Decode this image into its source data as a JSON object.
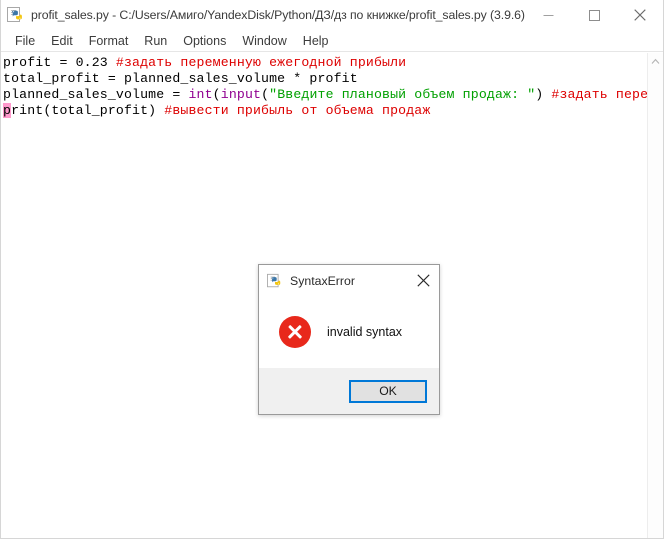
{
  "window": {
    "title": "profit_sales.py - C:/Users/Амиго/YandexDisk/Python/ДЗ/дз по книжке/profit_sales.py (3.9.6)",
    "app_icon": "python-icon",
    "controls": {
      "minimize": "minimize-icon",
      "maximize": "maximize-icon",
      "close": "close-icon"
    }
  },
  "menubar": {
    "items": [
      {
        "label": "File"
      },
      {
        "label": "Edit"
      },
      {
        "label": "Format"
      },
      {
        "label": "Run"
      },
      {
        "label": "Options"
      },
      {
        "label": "Window"
      },
      {
        "label": "Help"
      }
    ]
  },
  "editor": {
    "lines": [
      {
        "segments": [
          {
            "text": "profit = 0.23 ",
            "kind": "plain"
          },
          {
            "text": "#задать переменную ежегодной прибыли",
            "kind": "comment"
          }
        ]
      },
      {
        "segments": [
          {
            "text": "total_profit = planned_sales_volume * profit",
            "kind": "plain"
          }
        ]
      },
      {
        "segments": [
          {
            "text": "planned_sales_volume = ",
            "kind": "plain"
          },
          {
            "text": "int",
            "kind": "builtin"
          },
          {
            "text": "(",
            "kind": "plain"
          },
          {
            "text": "input",
            "kind": "builtin"
          },
          {
            "text": "(",
            "kind": "plain"
          },
          {
            "text": "\"Введите плановый объем продаж: \"",
            "kind": "string"
          },
          {
            "text": ") ",
            "kind": "plain"
          },
          {
            "text": "#задать пере",
            "kind": "comment"
          }
        ]
      },
      {
        "segments": [
          {
            "text": "p",
            "kind": "error-highlight"
          },
          {
            "text": "rint(total_profit) ",
            "kind": "plain"
          },
          {
            "text": "#вывести прибыль от объема продаж",
            "kind": "comment"
          }
        ]
      }
    ],
    "scrollbar": {
      "up_arrow": "scroll-up-arrow-icon"
    }
  },
  "dialog": {
    "icon": "python-icon",
    "title": "SyntaxError",
    "close_icon": "close-icon",
    "error_icon": "error-circle-x-icon",
    "message": "invalid syntax",
    "ok_label": "OK"
  },
  "colors": {
    "comment": "#dd0000",
    "builtin": "#900090",
    "string": "#00a000",
    "error_highlight": "#ff99cc",
    "error_icon": "#e8281b",
    "focus_border": "#0078d7"
  }
}
